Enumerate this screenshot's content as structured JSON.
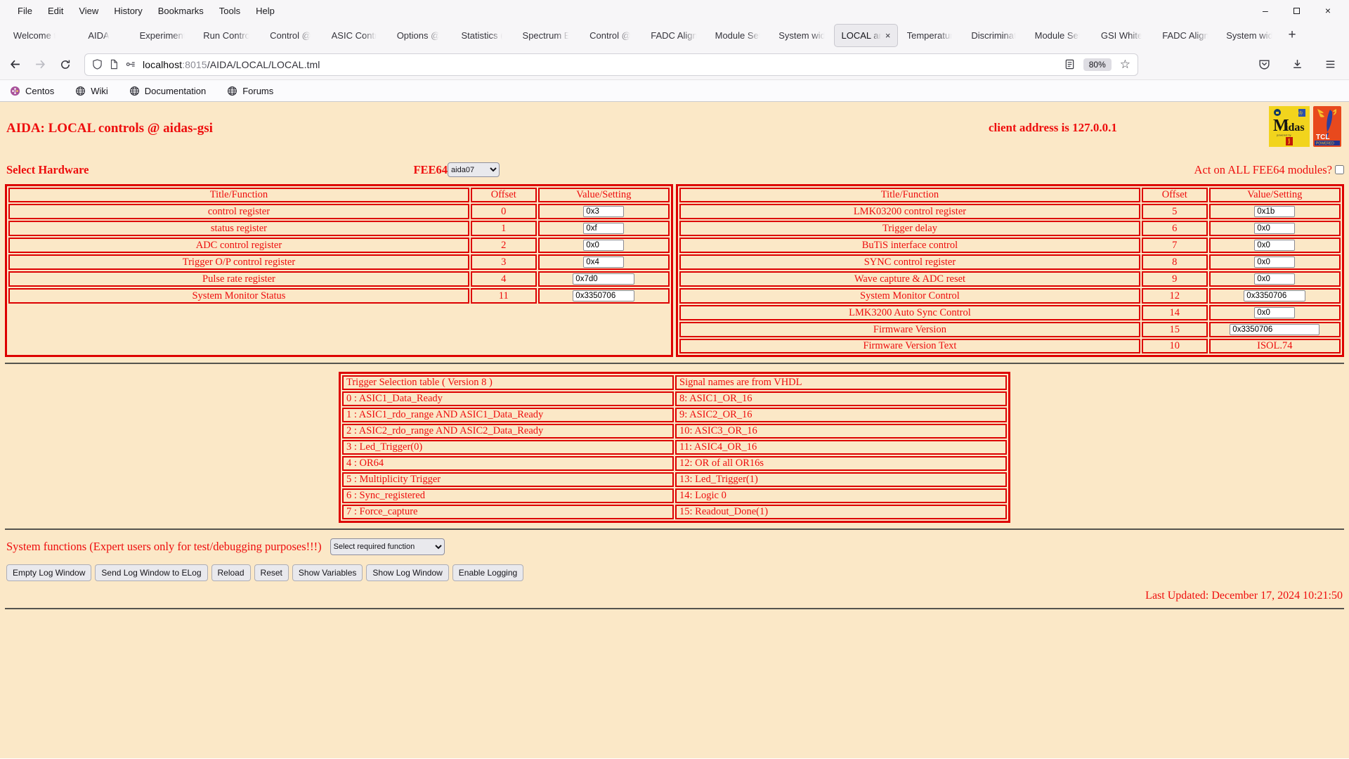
{
  "colors": {
    "text_red": "#ee0d0d",
    "border_red": "#dd0000",
    "page_bg": "#fbe8c7",
    "midas_yellow": "#f2d41d",
    "tcl_red": "#e8491d"
  },
  "browser": {
    "menu_items": [
      "File",
      "Edit",
      "View",
      "History",
      "Bookmarks",
      "Tools",
      "Help"
    ],
    "window_controls": {
      "minimize": "–",
      "close": "×"
    },
    "tabs": [
      {
        "label": "Welcome t"
      },
      {
        "label": "AIDA"
      },
      {
        "label": "Experiment"
      },
      {
        "label": "Run Contro"
      },
      {
        "label": "Control @"
      },
      {
        "label": "ASIC Contr"
      },
      {
        "label": "Options @"
      },
      {
        "label": "Statistics ("
      },
      {
        "label": "Spectrum E"
      },
      {
        "label": "Control @"
      },
      {
        "label": "FADC Align"
      },
      {
        "label": "Module Set"
      },
      {
        "label": "System wid"
      },
      {
        "label": "LOCAL ar",
        "active": true
      },
      {
        "label": "Temperatur"
      },
      {
        "label": "Discriminat"
      },
      {
        "label": "Module Set"
      },
      {
        "label": "GSI White"
      },
      {
        "label": "FADC Align"
      },
      {
        "label": "System wid"
      }
    ],
    "tab_close_glyph": "×",
    "new_tab_glyph": "+",
    "url": {
      "host": "localhost",
      "port": ":8015",
      "path": "/AIDA/LOCAL/LOCAL.tml"
    },
    "zoom_level": "80%",
    "star_glyph": "☆",
    "bookmarks": [
      "Centos",
      "Wiki",
      "Documentation",
      "Forums"
    ]
  },
  "page": {
    "title": "AIDA: LOCAL controls @ aidas-gsi",
    "client_address": "client address is 127.0.0.1",
    "logo_midas_text": "Midas",
    "logo_tcl_text": "TCL",
    "logo_tcl_powered": "POWERED",
    "select_hardware_label": "Select Hardware",
    "fee64_label": "FEE64",
    "fee64_value": "aida07",
    "act_on_all_label": "Act on ALL FEE64 modules?",
    "register_headers": [
      "Title/Function",
      "Offset",
      "Value/Setting"
    ],
    "registers_left": [
      {
        "title": "control register",
        "offset": "0",
        "value": "0x3"
      },
      {
        "title": "status register",
        "offset": "1",
        "value": "0xf"
      },
      {
        "title": "ADC control register",
        "offset": "2",
        "value": "0x0"
      },
      {
        "title": "Trigger O/P control register",
        "offset": "3",
        "value": "0x4"
      },
      {
        "title": "Pulse rate register",
        "offset": "4",
        "value": "0x7d0"
      },
      {
        "title": "System Monitor Status",
        "offset": "11",
        "value": "0x3350706"
      }
    ],
    "registers_right": [
      {
        "title": "LMK03200 control register",
        "offset": "5",
        "value": "0x1b"
      },
      {
        "title": "Trigger delay",
        "offset": "6",
        "value": "0x0"
      },
      {
        "title": "BuTiS interface control",
        "offset": "7",
        "value": "0x0"
      },
      {
        "title": "SYNC control register",
        "offset": "8",
        "value": "0x0"
      },
      {
        "title": "Wave capture & ADC reset",
        "offset": "9",
        "value": "0x0"
      },
      {
        "title": "System Monitor Control",
        "offset": "12",
        "value": "0x3350706"
      },
      {
        "title": "LMK3200 Auto Sync Control",
        "offset": "14",
        "value": "0x0"
      },
      {
        "title": "Firmware Version",
        "offset": "15",
        "value": "0x3350706",
        "wide": true
      },
      {
        "title": "Firmware Version Text",
        "offset": "10",
        "value": "ISOL.74",
        "readonly": true
      }
    ],
    "trigger_rows": [
      [
        "Trigger Selection table ( Version 8 )",
        "Signal names are from VHDL"
      ],
      [
        "0 : ASIC1_Data_Ready",
        "8: ASIC1_OR_16"
      ],
      [
        "1 : ASIC1_rdo_range AND ASIC1_Data_Ready",
        "9: ASIC2_OR_16"
      ],
      [
        "2 : ASIC2_rdo_range AND ASIC2_Data_Ready",
        "10: ASIC3_OR_16"
      ],
      [
        "3 : Led_Trigger(0)",
        "11: ASIC4_OR_16"
      ],
      [
        "4 : OR64",
        "12: OR of all OR16s"
      ],
      [
        "5 : Multiplicity Trigger",
        "13: Led_Trigger(1)"
      ],
      [
        "6 : Sync_registered",
        "14: Logic 0"
      ],
      [
        "7 : Force_capture",
        "15: Readout_Done(1)"
      ]
    ],
    "system_functions_label": "System functions (Expert users only for test/debugging purposes!!!)",
    "system_functions_select": "Select required function",
    "buttons": [
      "Empty Log Window",
      "Send Log Window to ELog",
      "Reload",
      "Reset",
      "Show Variables",
      "Show Log Window",
      "Enable Logging"
    ],
    "last_updated": "Last Updated: December 17, 2024 10:21:50"
  }
}
